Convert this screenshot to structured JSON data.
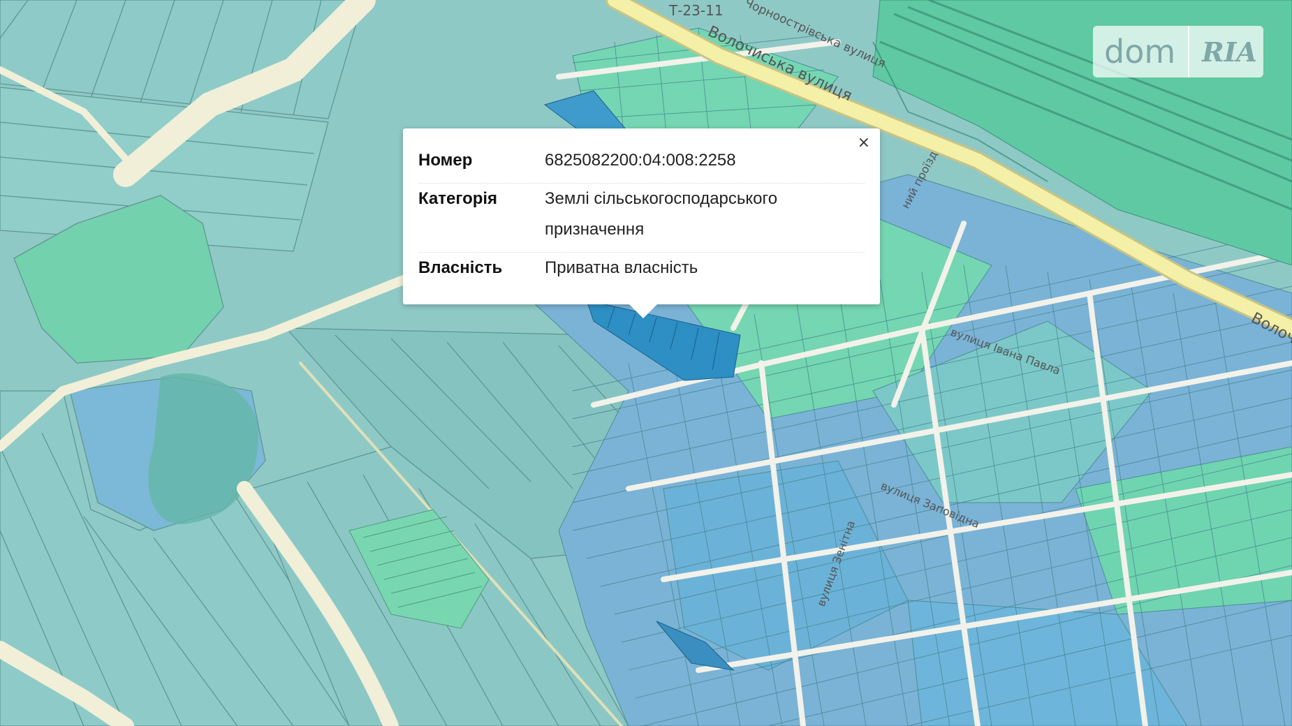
{
  "popup": {
    "close_label": "×",
    "rows": [
      {
        "key": "Номер",
        "value": "6825082200:04:008:2258"
      },
      {
        "key": "Категорія",
        "value": "Землі сільськогосподарського призначення"
      },
      {
        "key": "Власність",
        "value": "Приватна власність"
      }
    ]
  },
  "logo": {
    "left": "dom",
    "right": "RIA"
  },
  "map_labels": {
    "road_code": "Т-23-11",
    "volochyska": "Волочиська вулиця",
    "volochyska_2": "Волоч",
    "chornoostrivska": "Чорноострівська вулиця",
    "proizd": "ний проїзд",
    "street_a": "вулиця Івана Павла",
    "street_b": "вулиця Зенітна",
    "street_c": "вулиця Заповідна"
  },
  "colors": {
    "field": "#8fc9c6",
    "field_line": "#5f9692",
    "residential_blue": "#7ab3d6",
    "residential_green": "#6fd4b0",
    "selected": "#2d8fc4",
    "road": "#f1efd8",
    "main_road": "#f4f0a8"
  }
}
